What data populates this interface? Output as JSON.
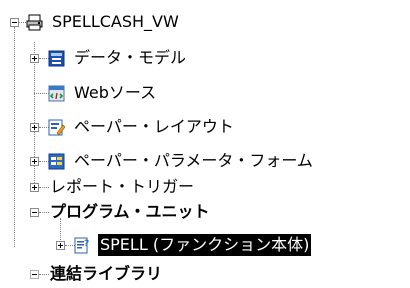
{
  "tree": {
    "root": {
      "label": "SPELLCASH_VW",
      "icon": "printer-icon"
    },
    "items": [
      {
        "label": "データ・モデル",
        "icon": "data-model-icon",
        "expander": "plus",
        "bold": false,
        "selected": false
      },
      {
        "label": "Webソース",
        "icon": "web-source-icon",
        "expander": "none",
        "bold": false,
        "selected": false
      },
      {
        "label": "ペーパー・レイアウト",
        "icon": "paper-layout-icon",
        "expander": "plus",
        "bold": false,
        "selected": false
      },
      {
        "label": "ペーパー・パラメータ・フォーム",
        "icon": "parameter-form-icon",
        "expander": "plus",
        "bold": false,
        "selected": false
      },
      {
        "label": "レポート・トリガー",
        "icon": "",
        "expander": "plus",
        "bold": false,
        "selected": false
      },
      {
        "label": "プログラム・ユニット",
        "icon": "",
        "expander": "minus",
        "bold": true,
        "selected": false
      },
      {
        "label": "SPELL (ファンクション本体)",
        "icon": "function-icon",
        "expander": "plus",
        "bold": false,
        "selected": true
      },
      {
        "label": "連結ライブラリ",
        "icon": "",
        "expander": "empty",
        "bold": true,
        "selected": false
      }
    ]
  }
}
